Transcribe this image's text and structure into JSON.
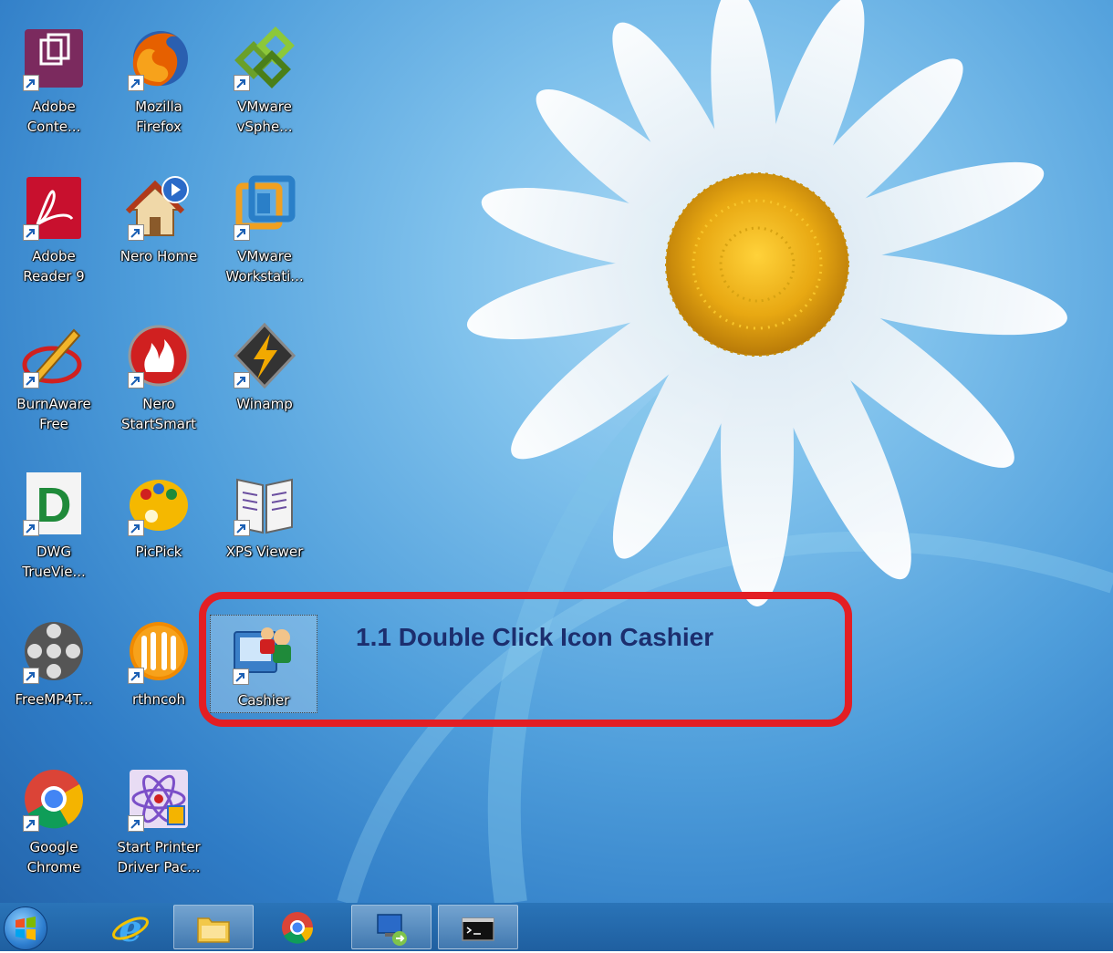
{
  "desktop": {
    "icons": [
      {
        "id": "adobe-contribute",
        "lines": [
          "Adobe",
          "Conte..."
        ],
        "color": "#7b2a5e"
      },
      {
        "id": "mozilla-firefox",
        "lines": [
          "Mozilla",
          "Firefox"
        ],
        "color": "#e66000"
      },
      {
        "id": "vmware-vsphere",
        "lines": [
          "VMware",
          "vSphe..."
        ],
        "color": "#6aa02a"
      },
      {
        "id": "adobe-reader",
        "lines": [
          "Adobe",
          "Reader 9"
        ],
        "color": "#c8102e"
      },
      {
        "id": "nero-home",
        "lines": [
          "Nero Home"
        ],
        "color": "#2a6ac8"
      },
      {
        "id": "vmware-workstation",
        "lines": [
          "VMware",
          "Workstati..."
        ],
        "color": "#f0a020"
      },
      {
        "id": "burnaware-free",
        "lines": [
          "BurnAware",
          "Free"
        ],
        "color": "#d02020"
      },
      {
        "id": "nero-startsmart",
        "lines": [
          "Nero",
          "StartSmart"
        ],
        "color": "#d02020"
      },
      {
        "id": "winamp",
        "lines": [
          "Winamp"
        ],
        "color": "#f2a900"
      },
      {
        "id": "dwg-trueview",
        "lines": [
          "DWG",
          "TrueVie..."
        ],
        "color": "#1f8a3a"
      },
      {
        "id": "picpick",
        "lines": [
          "PicPick"
        ],
        "color": "#f5b800"
      },
      {
        "id": "xps-viewer",
        "lines": [
          "XPS Viewer"
        ],
        "color": "#6b4fa0"
      },
      {
        "id": "freemp4",
        "lines": [
          "FreeMP4T..."
        ],
        "color": "#333333"
      },
      {
        "id": "rthncoh",
        "lines": [
          "rthncoh"
        ],
        "color": "#f08a00"
      },
      {
        "id": "cashier",
        "lines": [
          "Cashier"
        ],
        "color": "#3a7fc8"
      },
      {
        "id": "google-chrome",
        "lines": [
          "Google",
          "Chrome"
        ],
        "color": "#db4437"
      },
      {
        "id": "start-printer",
        "lines": [
          "Start Printer",
          "Driver Pac..."
        ],
        "color": "#7b4fc8"
      }
    ]
  },
  "callout": {
    "text": "1.1 Double Click Icon Cashier",
    "highlight_color": "#e31e24",
    "text_color": "#1c2e6e"
  },
  "taskbar": {
    "items": [
      "start-button",
      "internet-explorer",
      "file-explorer",
      "google-chrome",
      "remote-desktop",
      "command-prompt"
    ]
  }
}
